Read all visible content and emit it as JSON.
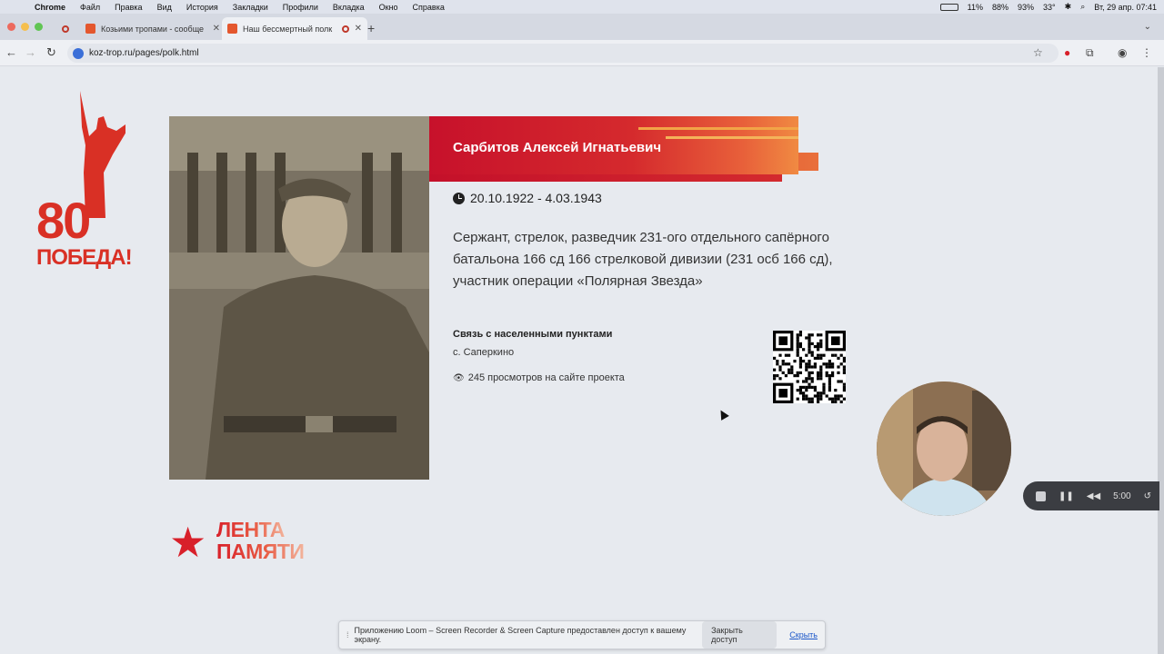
{
  "menubar": {
    "app": "Chrome",
    "items": [
      "Файл",
      "Правка",
      "Вид",
      "История",
      "Закладки",
      "Профили",
      "Вкладка",
      "Окно",
      "Справка"
    ],
    "status": {
      "cpu": "11%",
      "battery1": "88%",
      "battery2": "93%",
      "temp": "33°",
      "datetime": "Вт, 29 апр. 07:41"
    }
  },
  "tabs": [
    {
      "title": "Козьими тропами - сообще",
      "active": false
    },
    {
      "title": "Наш бессмертный полк",
      "active": true
    }
  ],
  "address": {
    "url": "koz-trop.ru/pages/polk.html"
  },
  "page": {
    "logo80": {
      "number": "80",
      "word": "ПОБЕДА!"
    },
    "person": {
      "name": "Сарбитов Алексей Игнатьевич",
      "dates": "20.10.1922 - 4.03.1943",
      "bio": "Сержант, стрелок, разведчик 231-ого отдельного сапёрного батальона 166 сд 166 стрелковой дивизии (231 осб 166 сд), участник операции «Полярная Звезда»",
      "links_title": "Связь с населенными пунктами",
      "links_value": "с. Саперкино",
      "views": "245 просмотров на сайте проекта"
    },
    "lenta": {
      "line1": "ЛЕНТА",
      "line2": "ПАМЯТИ"
    }
  },
  "loom": {
    "timer": "5:00"
  },
  "share_bar": {
    "message": "Приложению Loom – Screen Recorder & Screen Capture предоставлен доступ к вашему экрану.",
    "stop_label": "Закрыть доступ",
    "hide_label": "Скрыть"
  },
  "colors": {
    "accent_red": "#d8202a",
    "page_bg": "#e7eaef"
  }
}
